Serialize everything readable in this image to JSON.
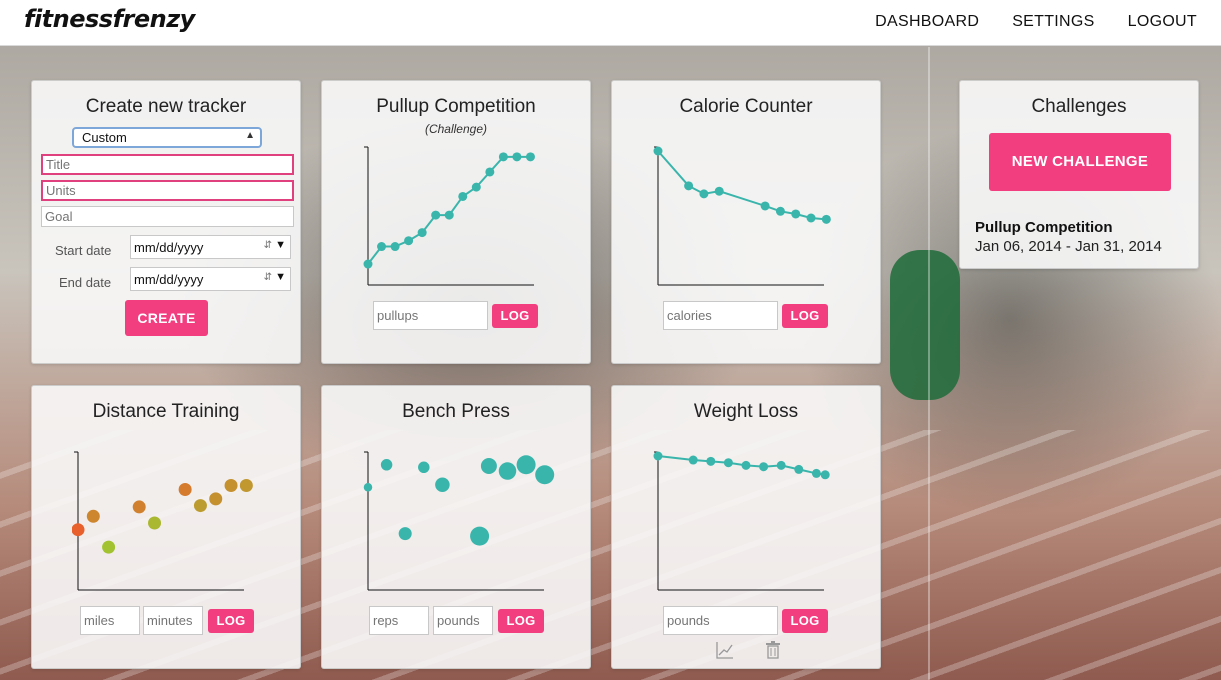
{
  "header": {
    "logo": "fitnessfrenzy",
    "nav": [
      "DASHBOARD",
      "SETTINGS",
      "LOGOUT"
    ]
  },
  "create_tracker": {
    "title": "Create new tracker",
    "type_select": "Custom",
    "title_placeholder": "Title",
    "units_placeholder": "Units",
    "goal_placeholder": "Goal",
    "start_label": "Start date",
    "end_label": "End date",
    "start_value": "mm/dd/yyyy",
    "end_value": "mm/dd/yyyy",
    "create_button": "CREATE"
  },
  "pullup": {
    "title": "Pullup Competition",
    "subtitle": "(Challenge)",
    "input_placeholder": "pullups",
    "log_button": "LOG"
  },
  "calorie": {
    "title": "Calorie Counter",
    "input_placeholder": "calories",
    "log_button": "LOG"
  },
  "challenges": {
    "title": "Challenges",
    "new_button": "NEW CHALLENGE",
    "item_name": "Pullup Competition",
    "item_dates": "Jan 06, 2014 - Jan 31, 2014"
  },
  "distance": {
    "title": "Distance Training",
    "input1_placeholder": "miles",
    "input2_placeholder": "minutes",
    "log_button": "LOG"
  },
  "bench": {
    "title": "Bench Press",
    "input1_placeholder": "reps",
    "input2_placeholder": "pounds",
    "log_button": "LOG"
  },
  "weight": {
    "title": "Weight Loss",
    "input_placeholder": "pounds",
    "log_button": "LOG",
    "icons": [
      "chart-icon",
      "trash-icon"
    ]
  },
  "colors": {
    "accent": "#f23d7e",
    "series": "#3ab5ac",
    "distance_low": "#9acd32",
    "distance_high": "#e8602c"
  },
  "chart_data": [
    {
      "type": "line",
      "name": "pullup",
      "x": [
        0,
        1,
        2,
        3,
        4,
        5,
        6,
        7,
        8,
        9,
        10,
        11,
        12
      ],
      "y": [
        0.18,
        0.33,
        0.33,
        0.38,
        0.45,
        0.6,
        0.6,
        0.76,
        0.84,
        0.97,
        1.1,
        1.1,
        1.1
      ],
      "xdomain": [
        0,
        13
      ],
      "ydomain": [
        0,
        1.15
      ]
    },
    {
      "type": "line",
      "name": "calorie",
      "x": [
        0,
        2,
        3,
        4,
        7,
        8,
        9,
        10,
        11
      ],
      "y": [
        1,
        0.74,
        0.68,
        0.7,
        0.59,
        0.55,
        0.53,
        0.5,
        0.49
      ],
      "xdomain": [
        0,
        11.5
      ],
      "ydomain": [
        0,
        1
      ]
    },
    {
      "type": "scatter",
      "name": "distance",
      "points": [
        [
          0,
          0.45,
          1
        ],
        [
          1,
          0.55,
          0.65
        ],
        [
          2,
          0.32,
          0.1
        ],
        [
          4,
          0.62,
          0.7
        ],
        [
          5,
          0.5,
          0.2
        ],
        [
          7,
          0.75,
          0.75
        ],
        [
          8,
          0.63,
          0.45
        ],
        [
          9,
          0.68,
          0.55
        ],
        [
          10,
          0.78,
          0.55
        ],
        [
          11,
          0.78,
          0.5
        ]
      ],
      "xdomain": [
        0,
        11.5
      ],
      "ydomain": [
        0,
        1
      ]
    },
    {
      "type": "scatter",
      "name": "bench",
      "points": [
        [
          0,
          0.82,
          3
        ],
        [
          1,
          1.0,
          5
        ],
        [
          2,
          0.45,
          6
        ],
        [
          3,
          0.98,
          5
        ],
        [
          4,
          0.84,
          7
        ],
        [
          6,
          0.43,
          10
        ],
        [
          6.5,
          0.99,
          8
        ],
        [
          7.5,
          0.95,
          9
        ],
        [
          8.5,
          1.0,
          10
        ],
        [
          9.5,
          0.92,
          10
        ]
      ],
      "xdomain": [
        0,
        10
      ],
      "ydomain": [
        0,
        1.07
      ]
    },
    {
      "type": "line",
      "name": "weight",
      "x": [
        0,
        2,
        3,
        4,
        5,
        6,
        7,
        8,
        9,
        9.5
      ],
      "y": [
        1,
        0.97,
        0.96,
        0.95,
        0.93,
        0.92,
        0.93,
        0.9,
        0.87,
        0.86
      ],
      "xdomain": [
        0,
        10
      ],
      "ydomain": [
        0,
        1
      ]
    }
  ]
}
